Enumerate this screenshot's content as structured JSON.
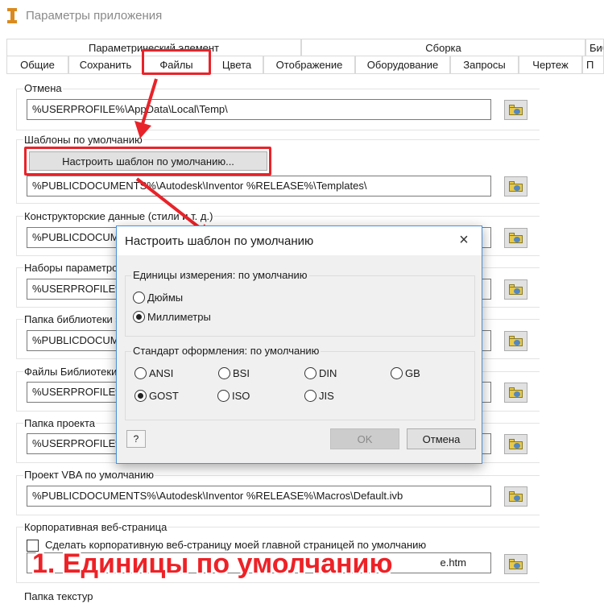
{
  "window": {
    "title": "Параметры приложения",
    "icon": "inventor-icon"
  },
  "tabs": {
    "row1": [
      "Параметрический элемент",
      "Сборка",
      "Бибт"
    ],
    "row2": [
      "Общие",
      "Сохранить",
      "Файлы",
      "Цвета",
      "Отображение",
      "Оборудование",
      "Запросы",
      "Чертеж",
      "П"
    ],
    "active": "Файлы"
  },
  "files": {
    "undo": {
      "label": "Отмена",
      "path": "%USERPROFILE%\\AppData\\Local\\Temp\\"
    },
    "templates": {
      "label": "Шаблоны по умолчанию",
      "button": "Настроить шаблон по умолчанию...",
      "path": "%PUBLICDOCUMENTS%\\Autodesk\\Inventor %RELEASE%\\Templates\\"
    },
    "design_data": {
      "label": "Конструкторские данные (стили и т. д.)",
      "path": "%PUBLICDOCUMENTS"
    },
    "param_sets": {
      "label": "Наборы параметров",
      "path": "%USERPROFILE%"
    },
    "lib_folder": {
      "label": "Папка библиотеки э",
      "path": "%PUBLICDOCUMENT"
    },
    "lib_files": {
      "label": "Файлы Библиотеки",
      "path": "%USERPROFILE%"
    },
    "project_folder": {
      "label": "Папка проекта",
      "path": "%USERPROFILE%"
    },
    "vba_project": {
      "label": "Проект VBA по умолчанию",
      "path": "%PUBLICDOCUMENTS%\\Autodesk\\Inventor %RELEASE%\\Macros\\Default.ivb"
    },
    "web_page": {
      "label": "Корпоративная веб-страница",
      "checkbox_label": "Сделать корпоративную веб-страницу моей главной страницей по умолчанию",
      "path_tail": "e.htm"
    },
    "textures": {
      "label": "Папка текстур"
    }
  },
  "dialog": {
    "title": "Настроить шаблон по умолчанию",
    "units": {
      "label": "Единицы измерения: по умолчанию",
      "options": [
        "Дюймы",
        "Миллиметры"
      ],
      "selected": "Миллиметры"
    },
    "standard": {
      "label": "Стандарт оформления: по умолчанию",
      "options": [
        "ANSI",
        "BSI",
        "DIN",
        "GB",
        "GOST",
        "ISO",
        "JIS"
      ],
      "selected": "GOST"
    },
    "ok": "OK",
    "cancel": "Отмена",
    "help": "?"
  },
  "annotation": {
    "caption": "1. Единицы по умолчанию",
    "color": "#ed2227"
  }
}
